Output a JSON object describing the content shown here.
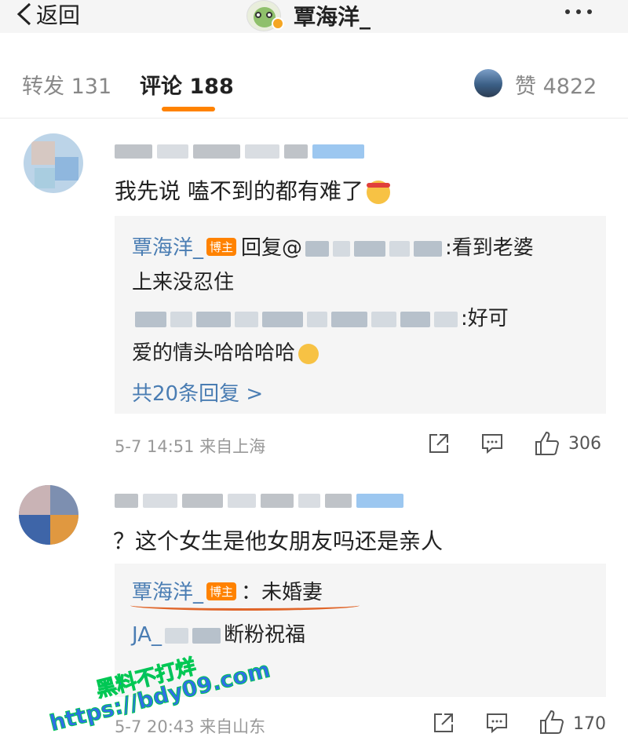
{
  "nav": {
    "back_label": "返回",
    "title": "覃海洋_"
  },
  "tabs": {
    "repost": "转发 131",
    "comment": "评论 188",
    "like": "赞 4822"
  },
  "comments": [
    {
      "text": "我先说 嗑不到的都有难了",
      "replies": {
        "r1_name": "覃海洋_",
        "r1_tag": "博主",
        "r1_pre": "回复@",
        "r1_post": ":看到老婆",
        "r1_cont": "上来没忍住",
        "r2_post": ":好可",
        "r2_cont": "爱的情头哈哈哈哈",
        "more": "共20条回复 >"
      },
      "meta": "5-7 14:51 来自上海",
      "likes": "306"
    },
    {
      "text": "？这个女生是他女朋友吗还是亲人",
      "replies": {
        "r1_name": "覃海洋_",
        "r1_tag": "博主",
        "r1_post": "：未婚妻",
        "r2_prefix": "JA_",
        "r2_post": "断粉祝福"
      },
      "meta": "5-7 20:43 来自山东",
      "likes": "170"
    }
  ],
  "watermark": {
    "line1": "黑料不打烊",
    "line2": "https://bdy09.com"
  },
  "colors": {
    "accent": "#ff8200",
    "link": "#4a7db3"
  }
}
